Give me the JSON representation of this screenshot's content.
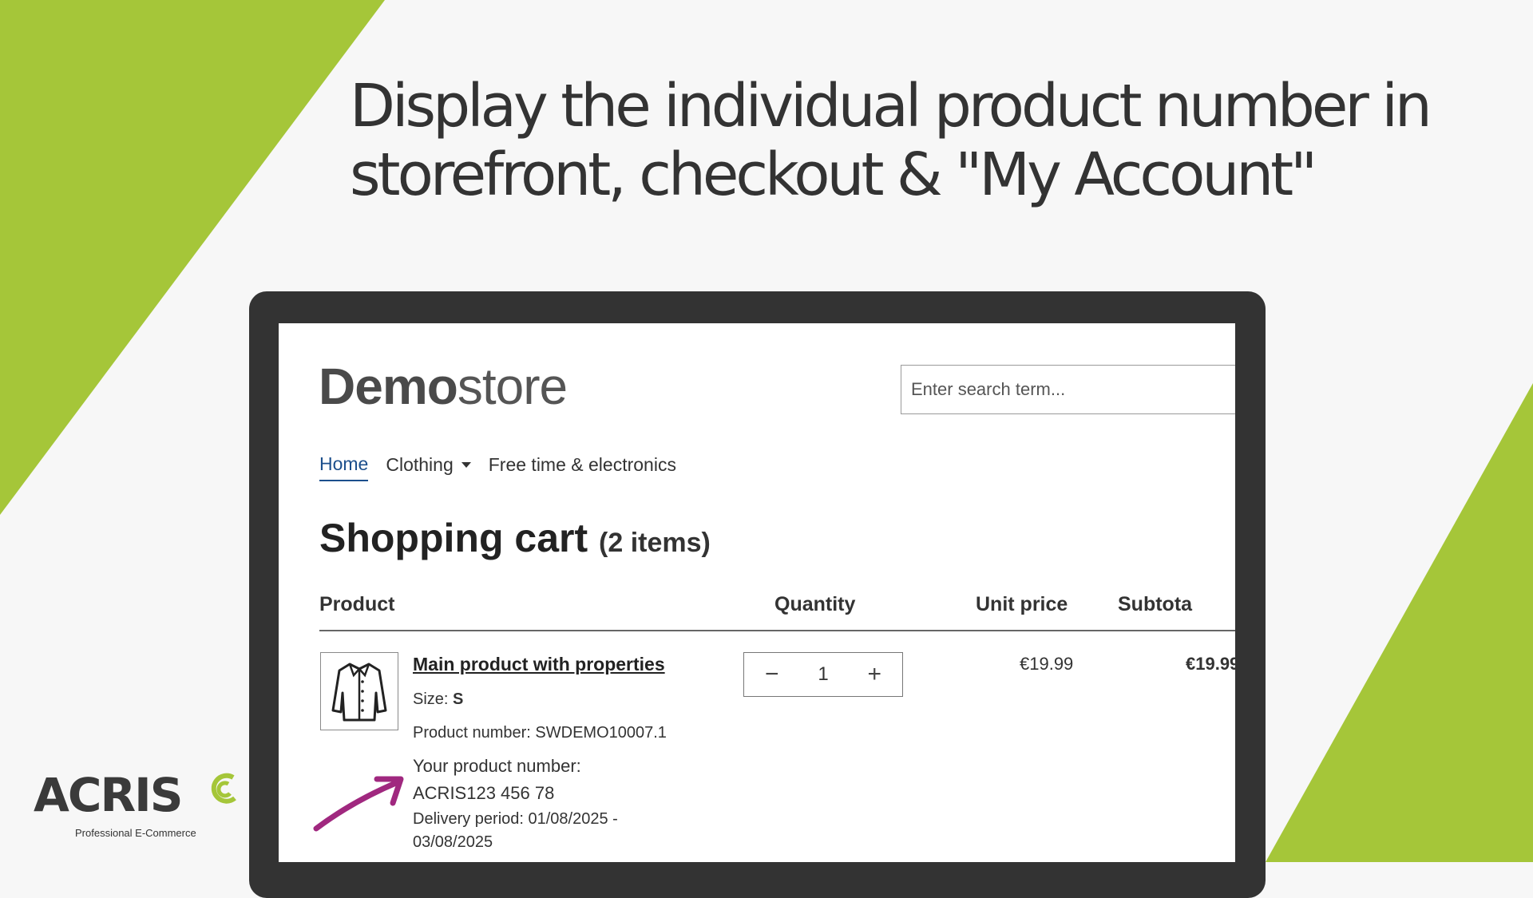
{
  "headline": {
    "line1": "Display the individual product number in",
    "line2": "storefront, checkout & \"My Account\""
  },
  "colors": {
    "accent_green": "#a5c639",
    "arrow_purple": "#a0287f",
    "dark_frame": "#333333"
  },
  "store": {
    "logo_bold": "Demo",
    "logo_light": "store",
    "search_placeholder": "Enter search term...",
    "nav": [
      {
        "label": "Home",
        "active": true
      },
      {
        "label": "Clothing",
        "has_dropdown": true
      },
      {
        "label": "Free time & electronics"
      }
    ]
  },
  "cart": {
    "title": "Shopping cart",
    "count": "(2 items)",
    "columns": [
      "Product",
      "Quantity",
      "Unit price",
      "Subtota"
    ],
    "item": {
      "icon": "jacket-icon",
      "name": "Main product with properties",
      "size_label": "Size: ",
      "size_value": "S",
      "product_number": "Product number: SWDEMO10007.1",
      "your_number_label": "Your product number:",
      "your_number_value": "ACRIS123 456 78",
      "delivery_line1": "Delivery period: 01/08/2025 -",
      "delivery_line2": "03/08/2025",
      "quantity": "1",
      "unit_price": "€19.99",
      "subtotal": "€19.99"
    }
  },
  "brand": {
    "name": "ACRIS",
    "tagline": "Professional E-Commerce"
  }
}
